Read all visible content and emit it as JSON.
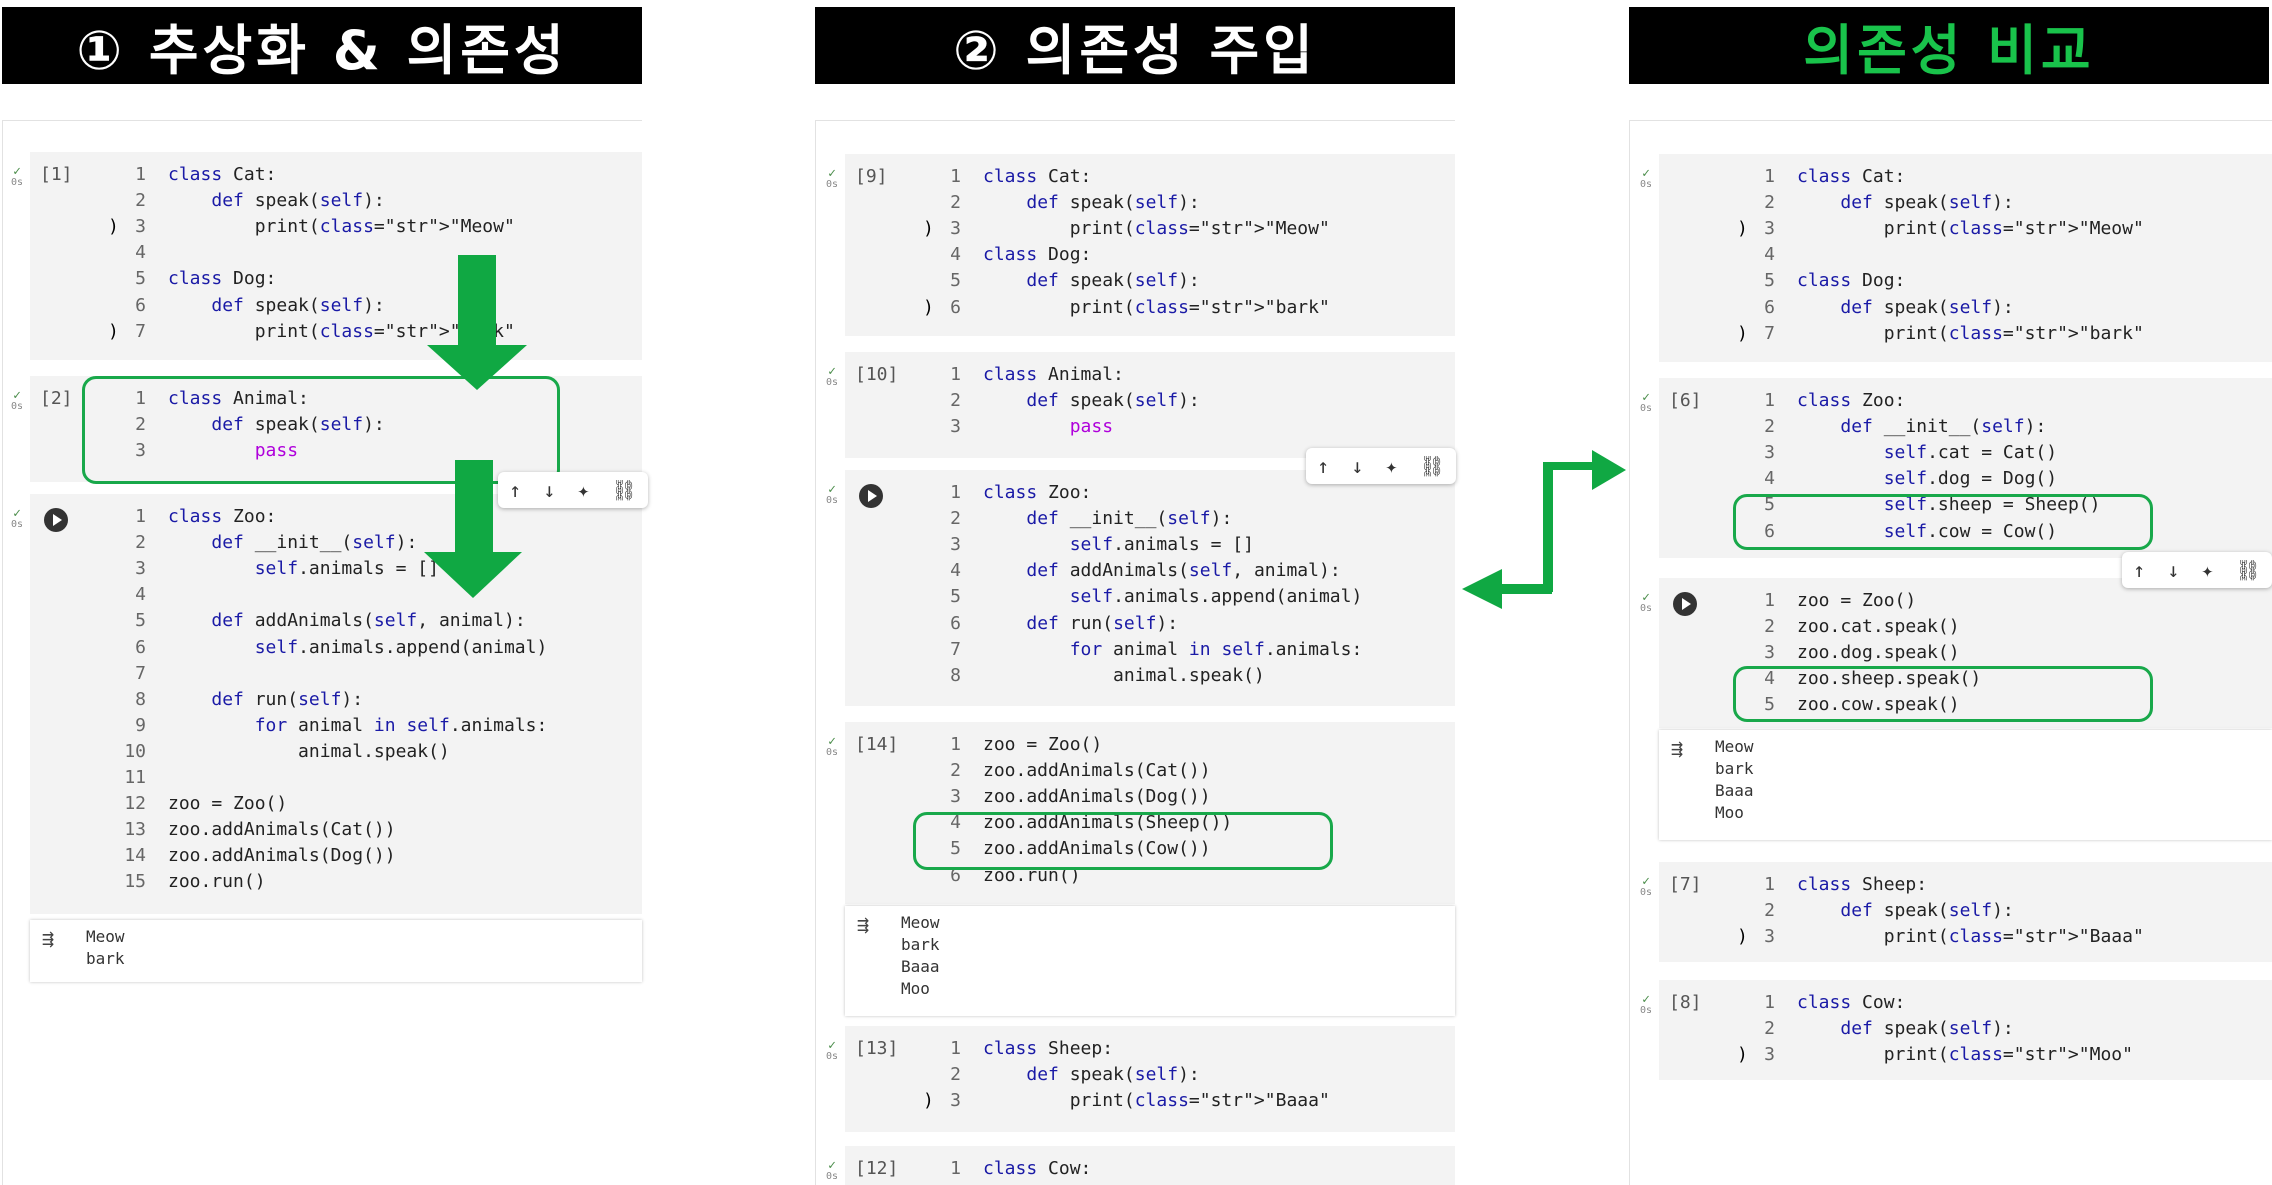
{
  "headers": {
    "h1": "① 추상화 & 의존성",
    "h2": "② 의존성 주입",
    "h3": "의존성 비교"
  },
  "panel1": {
    "cells": [
      {
        "num": "[1]",
        "lines": [
          "class Cat:",
          "    def speak(self):",
          "        print(\"Meow\")",
          "",
          "class Dog:",
          "    def speak(self):",
          "        print(\"bark\")"
        ]
      },
      {
        "num": "[2]",
        "lines": [
          "class Animal:",
          "    def speak(self):",
          "        pass"
        ]
      },
      {
        "num": "",
        "lines": [
          "class Zoo:",
          "    def __init__(self):",
          "        self.animals = []",
          "",
          "    def addAnimals(self, animal):",
          "        self.animals.append(animal)",
          "",
          "    def run(self):",
          "        for animal in self.animals:",
          "            animal.speak()",
          "",
          "zoo = Zoo()",
          "zoo.addAnimals(Cat())",
          "zoo.addAnimals(Dog())",
          "zoo.run()"
        ]
      }
    ],
    "output": [
      "Meow",
      "bark"
    ]
  },
  "panel2": {
    "cells": [
      {
        "num": "[9]",
        "lines": [
          "class Cat:",
          "    def speak(self):",
          "        print(\"Meow\")",
          "class Dog:",
          "    def speak(self):",
          "        print(\"bark\")"
        ]
      },
      {
        "num": "[10]",
        "lines": [
          "class Animal:",
          "    def speak(self):",
          "        pass"
        ]
      },
      {
        "num": "",
        "lines": [
          "class Zoo:",
          "    def __init__(self):",
          "        self.animals = []",
          "    def addAnimals(self, animal):",
          "        self.animals.append(animal)",
          "    def run(self):",
          "        for animal in self.animals:",
          "            animal.speak()"
        ]
      },
      {
        "num": "[14]",
        "lines": [
          "zoo = Zoo()",
          "zoo.addAnimals(Cat())",
          "zoo.addAnimals(Dog())",
          "zoo.addAnimals(Sheep())",
          "zoo.addAnimals(Cow())",
          "zoo.run()"
        ]
      },
      {
        "num": "[13]",
        "lines": [
          "class Sheep:",
          "    def speak(self):",
          "        print(\"Baaa\")"
        ]
      },
      {
        "num": "[12]",
        "lines": [
          "class Cow:"
        ]
      }
    ],
    "output": [
      "Meow",
      "bark",
      "Baaa",
      "Moo"
    ]
  },
  "panel3": {
    "cells": [
      {
        "num": "",
        "lines": [
          "class Cat:",
          "    def speak(self):",
          "        print(\"Meow\")",
          "",
          "class Dog:",
          "    def speak(self):",
          "        print(\"bark\")"
        ]
      },
      {
        "num": "[6]",
        "lines": [
          "class Zoo:",
          "    def __init__(self):",
          "        self.cat = Cat()",
          "        self.dog = Dog()",
          "        self.sheep = Sheep()",
          "        self.cow = Cow()"
        ]
      },
      {
        "num": "",
        "lines": [
          "zoo = Zoo()",
          "zoo.cat.speak()",
          "zoo.dog.speak()",
          "zoo.sheep.speak()",
          "zoo.cow.speak()"
        ]
      },
      {
        "num": "[7]",
        "lines": [
          "class Sheep:",
          "    def speak(self):",
          "        print(\"Baaa\")"
        ]
      },
      {
        "num": "[8]",
        "lines": [
          "class Cow:",
          "    def speak(self):",
          "        print(\"Moo\")"
        ]
      }
    ],
    "output": [
      "Meow",
      "bark",
      "Baaa",
      "Moo"
    ]
  },
  "gutter": {
    "check": "✓",
    "time": "0s"
  },
  "toolbar_icons": [
    "arrow-up-icon",
    "arrow-down-icon",
    "sparkle-icon",
    "link-icon"
  ],
  "colors": {
    "keyword": "#1a1aa6",
    "string": "#a31515",
    "highlight": "#18a84a",
    "arrow": "#10a843"
  }
}
